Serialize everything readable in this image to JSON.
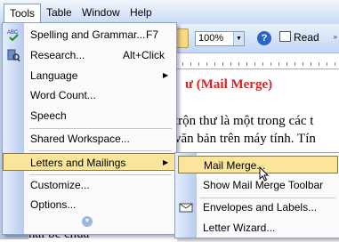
{
  "menubar": {
    "items": [
      {
        "label": "Tools",
        "active": true
      },
      {
        "label": "Table",
        "active": false
      },
      {
        "label": "Window",
        "active": false
      },
      {
        "label": "Help",
        "active": false
      }
    ]
  },
  "toolbar": {
    "zoom_value": "100%",
    "help_glyph": "?",
    "read_label": "Read"
  },
  "document": {
    "heading_fragment": "ư (Mail Merge)",
    "line1": "trộn thư là một trong các t",
    "line2": "văn bản trên máy tính. Tín",
    "bottom_fragment": "hai bé chuẩ"
  },
  "tools_menu": {
    "items": [
      {
        "label": "Spelling and Grammar...",
        "shortcut": "F7",
        "icon": "spelling-abc-icon"
      },
      {
        "label": "Research...",
        "shortcut": "Alt+Click",
        "icon": "research-book-icon"
      },
      {
        "label": "Language",
        "submenu": true
      },
      {
        "label": "Word Count..."
      },
      {
        "label": "Speech"
      },
      {
        "label": "Shared Workspace..."
      },
      {
        "label": "Letters and Mailings",
        "submenu": true,
        "highlighted": true
      },
      {
        "label": "Customize..."
      },
      {
        "label": "Options..."
      }
    ],
    "expand_glyph": "⌄⌄"
  },
  "letters_submenu": {
    "items": [
      {
        "label": "Mail Merge...",
        "highlighted": true
      },
      {
        "label": "Show Mail Merge Toolbar"
      },
      {
        "label": "Envelopes and Labels...",
        "icon": "envelope-icon"
      },
      {
        "label": "Letter Wizard..."
      }
    ]
  },
  "colors": {
    "menu_highlight": "#fbe59a",
    "heading_red": "#e02020",
    "gutter_blue": "#b7cbed"
  }
}
